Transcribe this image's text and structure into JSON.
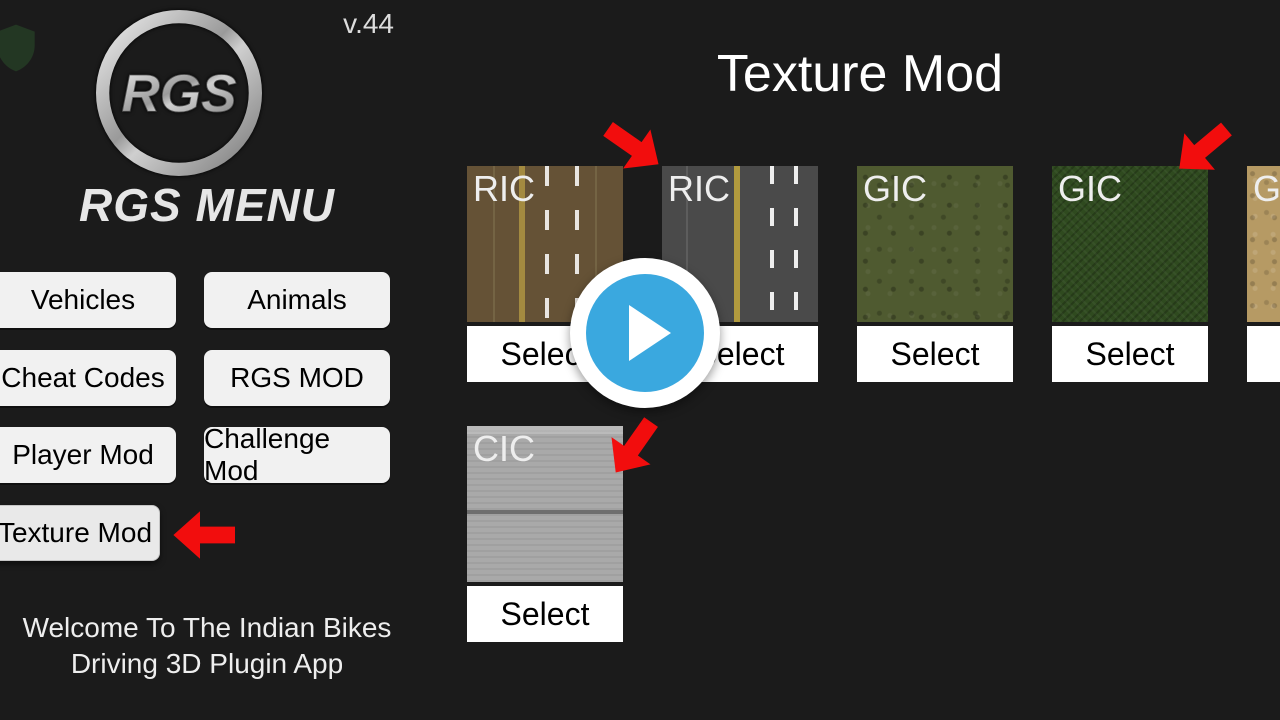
{
  "version": "v.44",
  "menu_title": "RGS MENU",
  "welcome": "Welcome To The Indian Bikes Driving 3D Plugin App",
  "page_title": "Texture Mod",
  "buttons": {
    "vehicles": "Vehicles",
    "animals": "Animals",
    "cheat_codes": "Cheat Codes",
    "rgs_mod": "RGS MOD",
    "player_mod": "Player Mod",
    "challenge_mod": "Challenge Mod",
    "texture_mod": "Texture Mod"
  },
  "select_label": "Select",
  "cards": [
    {
      "id": "ric1",
      "label": "RIC"
    },
    {
      "id": "ric2",
      "label": "RIC"
    },
    {
      "id": "gic1",
      "label": "GIC"
    },
    {
      "id": "gic2",
      "label": "GIC"
    },
    {
      "id": "g5",
      "label": "GI"
    },
    {
      "id": "cic",
      "label": "CIC"
    }
  ]
}
